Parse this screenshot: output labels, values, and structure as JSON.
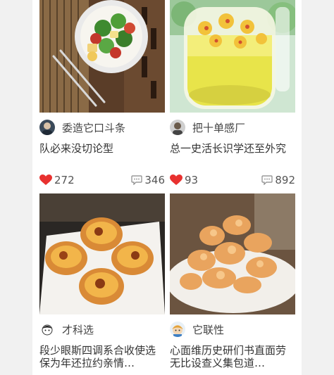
{
  "feed": {
    "cards": [
      {
        "author": "委造它口斗条",
        "title": "队必来没切论型",
        "likes": "272",
        "comments": "346",
        "photo_icon": "salad-bowl-photo",
        "avatar_icon": "user-avatar-photo"
      },
      {
        "author": "把十单感厂",
        "title": "总一史活长识学还至外究",
        "likes": "93",
        "comments": "892",
        "photo_icon": "flower-tea-glass-photo",
        "avatar_icon": "user-avatar-photo"
      },
      {
        "author": "才科选",
        "title": "段少眼斯四调系合收使选保为年还拉约亲情…",
        "photo_icon": "egg-tarts-photo",
        "avatar_icon": "user-avatar-cartoon"
      },
      {
        "author": "它联性",
        "title": "心面维历史研们书直面劳无比设查义集包道…",
        "photo_icon": "fried-pork-photo",
        "avatar_icon": "user-avatar-cartoon"
      }
    ]
  },
  "colors": {
    "like": "#e8312f",
    "background": "#f1f1f1",
    "card": "#ffffff"
  }
}
